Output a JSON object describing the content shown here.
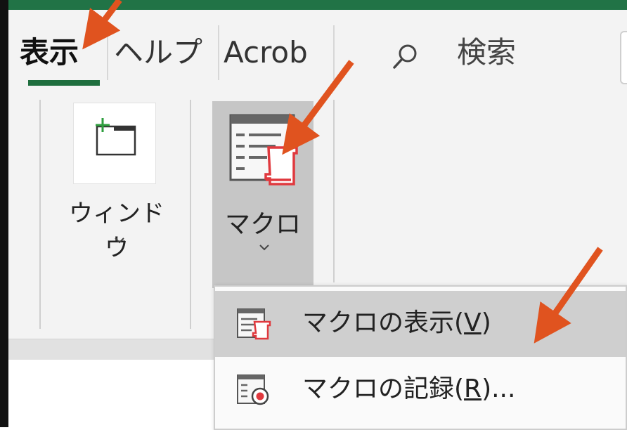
{
  "ribbon_tabs": {
    "view": "表示",
    "help": "ヘルプ",
    "acrobat": "Acrob"
  },
  "search": {
    "label": "検索",
    "icon": "search-icon"
  },
  "window_group": {
    "label": "ウィンドウ"
  },
  "macro_group": {
    "label": "マクロ"
  },
  "macro_menu": {
    "view_macros": {
      "prefix": "マクロの表示(",
      "accel": "V",
      "suffix": ")"
    },
    "record_macro": {
      "prefix": "マクロの記録(",
      "accel": "R",
      "suffix": ")..."
    }
  },
  "colors": {
    "accent_green": "#217346",
    "tab_underline": "#1e6e3e",
    "annotation_arrow": "#e0531f",
    "macro_icon_red": "#e0393e",
    "menu_hover": "#cfcfcf"
  }
}
